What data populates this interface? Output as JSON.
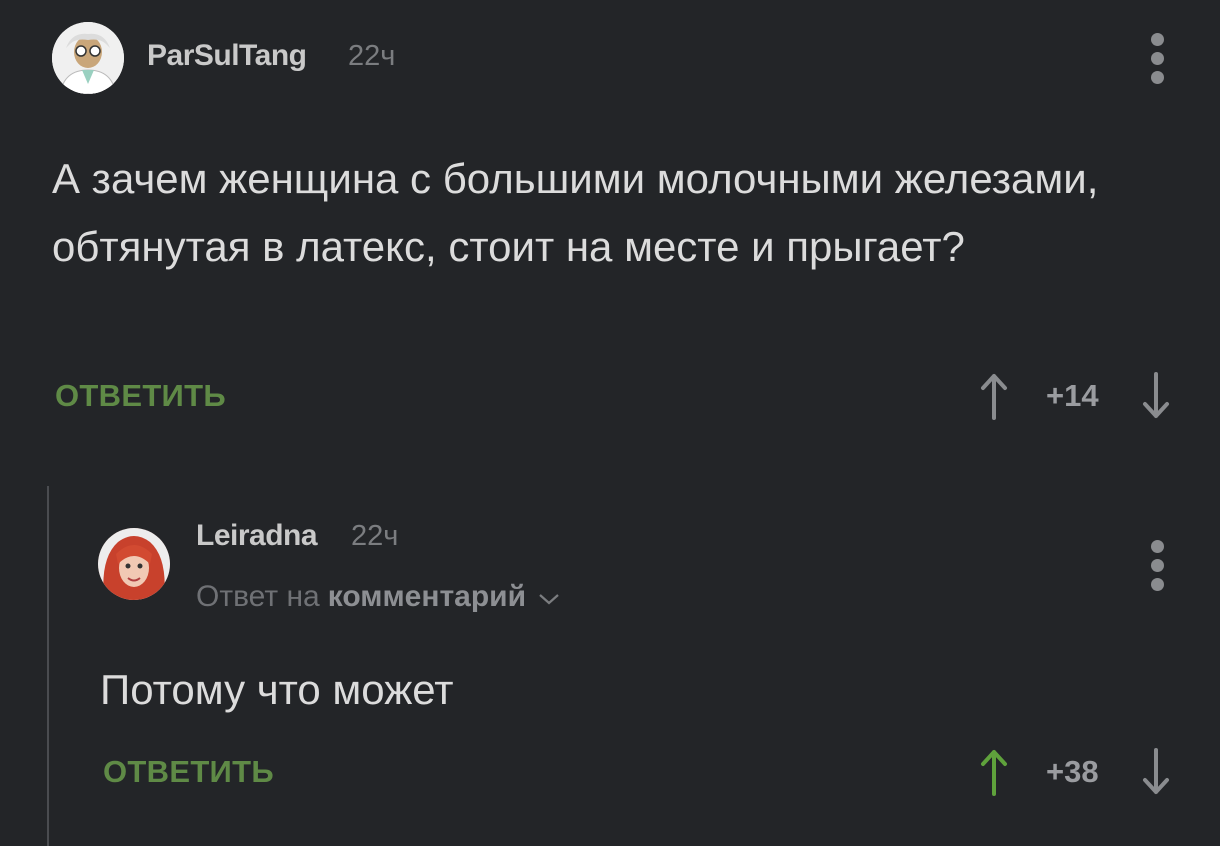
{
  "comments": [
    {
      "username": "ParSulTang",
      "time": "22ч",
      "text": "А зачем женщина с большими молочными железами, обтянутая в латекс, стоит на месте и прыгает?",
      "reply_label": "ОТВЕТИТЬ",
      "score": "+14",
      "upvoted": false
    },
    {
      "username": "Leiradna",
      "time": "22ч",
      "reply_to_prefix": "Ответ на",
      "reply_to_link": "комментарий",
      "text": "Потому что может",
      "reply_label": "ОТВЕТИТЬ",
      "score": "+38",
      "upvoted": true
    }
  ],
  "colors": {
    "background": "#232528",
    "reply_green": "#5f8a46",
    "upvote_active": "#5fa23c",
    "vote_inactive": "#8a8c8f"
  },
  "icons": {
    "more": "vertical-dots-icon",
    "upvote": "arrow-up-icon",
    "downvote": "arrow-down-icon",
    "expand": "chevron-down-icon"
  }
}
